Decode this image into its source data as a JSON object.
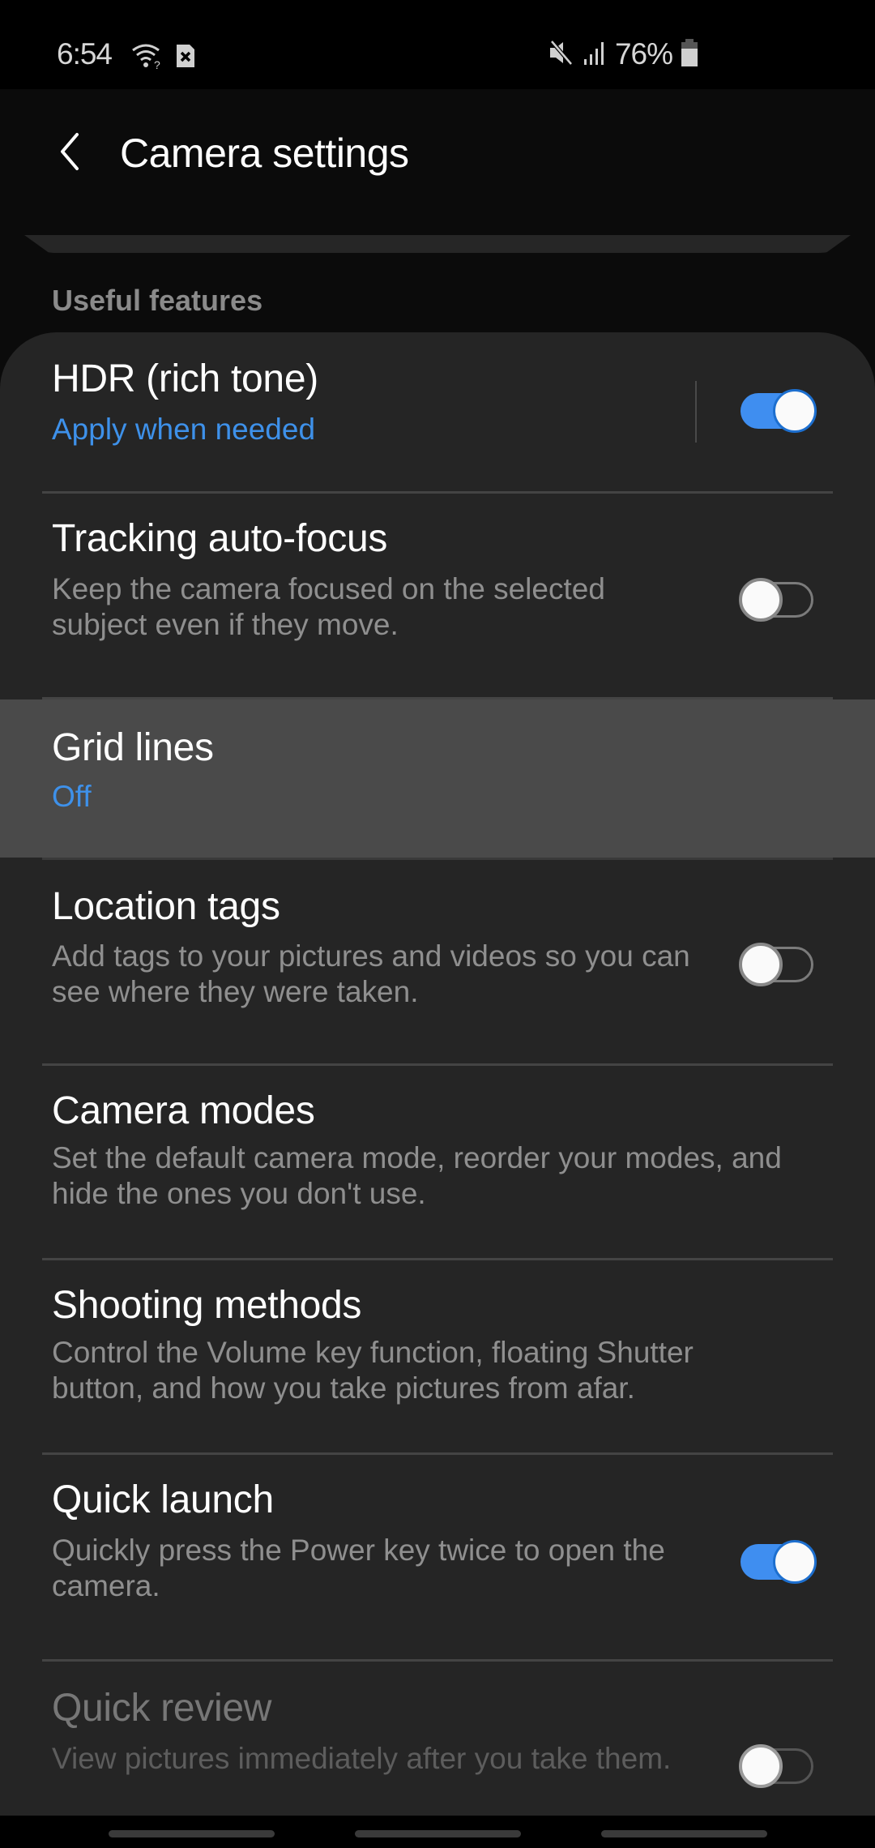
{
  "status_bar": {
    "time": "6:54",
    "left_icons": [
      "wifi-question-icon",
      "sim-error-icon"
    ],
    "right_icons": [
      "mute-icon",
      "signal-icon"
    ],
    "battery_percent": "76%",
    "battery_icon": "battery-icon"
  },
  "app_bar": {
    "back_icon": "chevron-left-icon",
    "title": "Camera settings"
  },
  "section": {
    "header": "Useful features"
  },
  "colors": {
    "accent": "#3f8ef0",
    "subtitle_blue": "#3e91ea",
    "card_bg": "#252525",
    "highlight_bg": "#4a4a4a"
  },
  "settings": [
    {
      "title": "HDR (rich tone)",
      "subtitle": "Apply when needed",
      "subtitle_style": "accent",
      "toggle": "on",
      "has_divider_before_toggle": true
    },
    {
      "title": "Tracking auto-focus",
      "subtitle": "Keep the camera focused on the selected subject even if they move.",
      "toggle": "off"
    },
    {
      "title": "Grid lines",
      "subtitle": "Off",
      "subtitle_style": "accent",
      "highlighted": true
    },
    {
      "title": "Location tags",
      "subtitle": "Add tags to your pictures and videos so you can see where they were taken.",
      "toggle": "off"
    },
    {
      "title": "Camera modes",
      "subtitle": "Set the default camera mode, reorder your modes, and hide the ones you don't use."
    },
    {
      "title": "Shooting methods",
      "subtitle": "Control the Volume key function, floating Shutter button, and how you take pictures from afar."
    },
    {
      "title": "Quick launch",
      "subtitle": "Quickly press the Power key twice to open the camera.",
      "toggle": "on"
    },
    {
      "title": "Quick review",
      "subtitle": "View pictures immediately after you take them.",
      "toggle": "off",
      "disabled": true
    }
  ],
  "nav_bar": {
    "buttons": [
      "recents-button",
      "home-button",
      "back-button"
    ]
  }
}
